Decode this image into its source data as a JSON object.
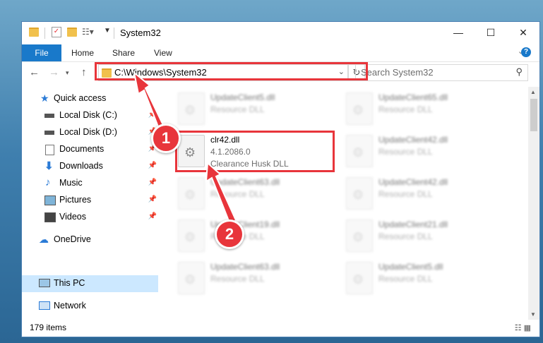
{
  "window": {
    "title": "System32"
  },
  "ribbon": {
    "tabs": [
      "File",
      "Home",
      "Share",
      "View"
    ]
  },
  "address": {
    "path": "C:\\Windows\\System32"
  },
  "search": {
    "placeholder": "Search System32"
  },
  "sidebar": {
    "items": [
      {
        "label": "Quick access",
        "icon": "star-icon"
      },
      {
        "label": "Local Disk (C:)",
        "icon": "drive-icon"
      },
      {
        "label": "Local Disk (D:)",
        "icon": "drive-icon"
      },
      {
        "label": "Documents",
        "icon": "documents-icon"
      },
      {
        "label": "Downloads",
        "icon": "download-icon"
      },
      {
        "label": "Music",
        "icon": "music-icon"
      },
      {
        "label": "Pictures",
        "icon": "pictures-icon"
      },
      {
        "label": "Videos",
        "icon": "videos-icon"
      },
      {
        "label": "OneDrive",
        "icon": "cloud-icon"
      },
      {
        "label": "This PC",
        "icon": "computer-icon"
      },
      {
        "label": "Network",
        "icon": "network-icon"
      }
    ]
  },
  "files": {
    "highlighted": {
      "name": "clr42.dll",
      "version": "4.1.2086.0",
      "description": "Clearance Husk DLL"
    },
    "left": [
      {
        "name": "UpdateClient5.dll",
        "type": "Resource DLL"
      },
      {
        "name": "UpdateClient63.dll",
        "type": "Resource DLL"
      },
      {
        "name": "UpdateClient19.dll",
        "type": "Resource DLL"
      },
      {
        "name": "UpdateClient63.dll",
        "type": "Resource DLL"
      }
    ],
    "right": [
      {
        "name": "UpdateClient65.dll",
        "type": "Resource DLL"
      },
      {
        "name": "UpdateClient42.dll",
        "type": "Resource DLL"
      },
      {
        "name": "UpdateClient42.dll",
        "type": "Resource DLL"
      },
      {
        "name": "UpdateClient21.dll",
        "type": "Resource DLL"
      },
      {
        "name": "UpdateClient5.dll",
        "type": "Resource DLL"
      }
    ]
  },
  "status": {
    "count": "179 items"
  },
  "annotations": {
    "step1": "1",
    "step2": "2"
  },
  "colors": {
    "accent": "#1979ca",
    "annotation": "#e8353b",
    "selected": "#cce8ff"
  }
}
